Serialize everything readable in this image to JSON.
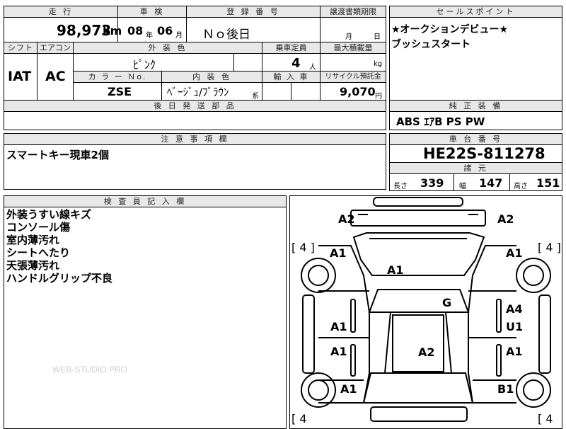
{
  "top": {
    "mileage_header": "走 行",
    "mileage_value": "98,973",
    "mileage_unit": "km",
    "inspection_header": "車 検",
    "inspection_year": "08",
    "inspection_year_unit": "年",
    "inspection_month": "06",
    "inspection_month_unit": "月",
    "registration_header": "登 録 番 号",
    "registration_value": "Ｎｏ後日",
    "transfer_header": "譲渡書類期限",
    "transfer_month": "月",
    "transfer_day": "日"
  },
  "row2": {
    "shift_header": "シフト",
    "shift_value": "IAT",
    "aircon_header": "エアコン",
    "aircon_value": "AC",
    "exterior_color_header": "外 装 色",
    "exterior_color_value": "ﾋﾟﾝｸ",
    "capacity_header": "乗車定員",
    "capacity_value": "4",
    "capacity_unit": "人",
    "max_load_header": "最大積載量",
    "max_load_unit": "kg",
    "color_no_header": "カ ラ ー Ｎo.",
    "color_no_value": "ZSE",
    "interior_header": "内 装 色",
    "interior_value": "ﾍﾞｰｼﾞｭ/ﾌﾞﾗｳﾝ",
    "interior_suffix": "系",
    "import_header": "輸 入 車",
    "recycle_header": "リサイクル預託金",
    "recycle_value": "9,070",
    "recycle_unit": "円",
    "later_parts_header": "後 日 発 送 部 品"
  },
  "sales": {
    "header": "セールスポイント",
    "line1": "★オークションデビュー★",
    "line2": "ブッシュスタート"
  },
  "equipment": {
    "header": "純 正 装 備",
    "value": "ABS ｴｱB PS PW"
  },
  "notes": {
    "header": "注 意 事 項 欄",
    "value": "スマートキー現車2個"
  },
  "chassis": {
    "header": "車 台 番 号",
    "value": "HE22S-811278",
    "specs_header": "諸 元",
    "length_label": "長さ",
    "length_value": "339",
    "width_label": "幅",
    "width_value": "147",
    "height_label": "高さ",
    "height_value": "151"
  },
  "inspector": {
    "header": "検 査 員 記 入 欄",
    "lines": [
      "外装うすい線キズ",
      "コンソール傷",
      "室内薄汚れ",
      "シートへたり",
      "天張薄汚れ",
      "ハンドルグリップ不良"
    ]
  },
  "diagram": {
    "tire_fl": "[ 4 ]",
    "tire_fr": "[ 4 ]",
    "tire_rl": "[ 4",
    "tire_rr": "[ 4",
    "a2_top_left": "A2",
    "a2_top_right": "A2",
    "a1_left_fender": "A1",
    "a1_right_fender": "A1",
    "a1_hood": "A1",
    "g_windshield": "G",
    "a1_front_door_left": "A1",
    "a4_front_door_right": "A4",
    "u1_front_door_right": "U1",
    "a1_rear_door_left": "A1",
    "a1_rear_door_right": "A1",
    "a2_roof": "A2",
    "a1_rear_left": "A1",
    "b1_rear_right": "B1"
  },
  "watermark": "WEB-STUDIO.PRO"
}
